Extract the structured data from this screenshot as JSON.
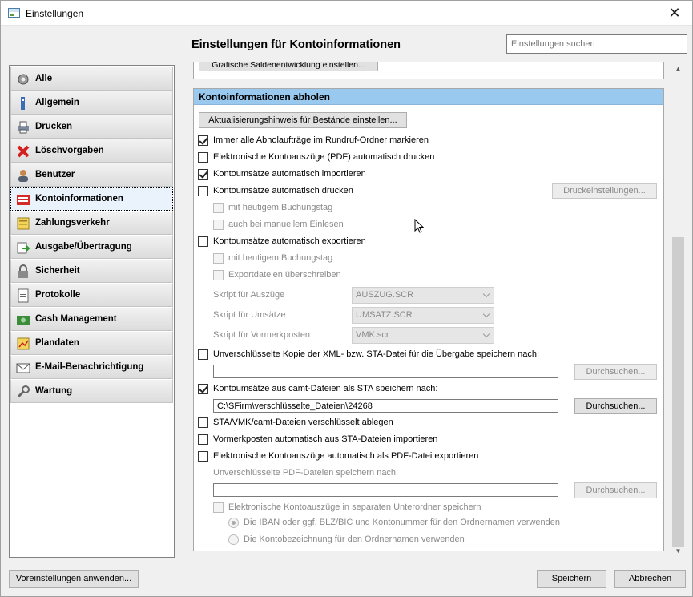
{
  "window": {
    "title": "Einstellungen",
    "close_glyph": "✕"
  },
  "header": {
    "title": "Einstellungen für Kontoinformationen",
    "search_placeholder": "Einstellungen suchen"
  },
  "sidebar": {
    "items": [
      {
        "label": "Alle",
        "icon": "gear-icon"
      },
      {
        "label": "Allgemein",
        "icon": "list-icon"
      },
      {
        "label": "Drucken",
        "icon": "printer-icon"
      },
      {
        "label": "Löschvorgaben",
        "icon": "delete-icon"
      },
      {
        "label": "Benutzer",
        "icon": "user-icon"
      },
      {
        "label": "Kontoinformationen",
        "icon": "account-info-icon",
        "active": true
      },
      {
        "label": "Zahlungsverkehr",
        "icon": "payment-icon"
      },
      {
        "label": "Ausgabe/Übertragung",
        "icon": "transfer-icon"
      },
      {
        "label": "Sicherheit",
        "icon": "lock-icon"
      },
      {
        "label": "Protokolle",
        "icon": "log-icon"
      },
      {
        "label": "Cash Management",
        "icon": "cash-icon"
      },
      {
        "label": "Plandaten",
        "icon": "plan-icon"
      },
      {
        "label": "E-Mail-Benachrichtigung",
        "icon": "email-icon"
      },
      {
        "label": "Wartung",
        "icon": "wrench-icon"
      }
    ]
  },
  "top_panel": {
    "button_label": "Grafische Saldenentwicklung einstellen..."
  },
  "section": {
    "title": "Kontoinformationen abholen",
    "update_hint_button": "Aktualisierungshinweis für Bestände einstellen...",
    "options": {
      "mark_rundruf": "Immer alle Abholaufträge im Rundruf-Ordner markieren",
      "print_pdf": "Elektronische Kontoauszüge (PDF) automatisch drucken",
      "import_auto": "Kontoumsätze automatisch importieren",
      "print_auto": "Kontoumsätze automatisch drucken",
      "print_settings_button": "Druckeinstellungen...",
      "print_today": "mit heutigem Buchungstag",
      "print_manual": "auch bei manuellem Einlesen",
      "export_auto": "Kontoumsätze automatisch exportieren",
      "export_today": "mit heutigem Buchungstag",
      "export_overwrite": "Exportdateien überschreiben",
      "script_auszuege_label": "Skript für Auszüge",
      "script_auszuege_value": "AUSZUG.SCR",
      "script_umsaetze_label": "Skript für Umsätze",
      "script_umsaetze_value": "UMSATZ.SCR",
      "script_vormerk_label": "Skript für Vormerkposten",
      "script_vormerk_value": "VMK.scr",
      "unencrypted_copy": "Unverschlüsselte Kopie der XML- bzw. STA-Datei für die Übergabe speichern nach:",
      "unencrypted_copy_path": "",
      "browse_label": "Durchsuchen...",
      "camt_as_sta": "Kontoumsätze aus camt-Dateien als STA speichern nach:",
      "camt_path": "C:\\SFirm\\verschlüsselte_Dateien\\24268",
      "sta_encrypted": "STA/VMK/camt-Dateien verschlüsselt ablegen",
      "vormerk_import": "Vormerkposten automatisch aus STA-Dateien importieren",
      "pdf_export": "Elektronische Kontoauszüge automatisch als PDF-Datei exportieren",
      "pdf_path_label": "Unverschlüsselte PDF-Dateien speichern nach:",
      "pdf_path": "",
      "pdf_subfolder": "Elektronische Kontoauszüge in separaten Unterordner speichern",
      "radio_iban": "Die IBAN oder ggf. BLZ/BIC und Kontonummer für den Ordnernamen verwenden",
      "radio_bezeichnung": "Die Kontobezeichnung für den Ordnernamen verwenden"
    }
  },
  "footer": {
    "defaults_button": "Voreinstellungen anwenden...",
    "save_button": "Speichern",
    "cancel_button": "Abbrechen"
  },
  "colors": {
    "section_header": "#99c9ef",
    "active_sidebar": "#eaf2fb"
  }
}
